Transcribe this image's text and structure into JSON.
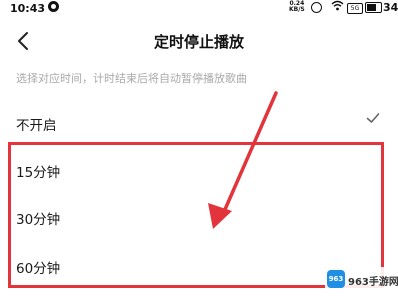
{
  "status_bar": {
    "time": "10:43",
    "speed_value": "0.24",
    "speed_unit": "KB/S",
    "signal_badge": "5G",
    "battery": "34",
    "battery_level": 0.34
  },
  "header": {
    "title": "定时停止播放"
  },
  "hint": "选择对应时间，计时结束后将自动暂停播放歌曲",
  "options": [
    {
      "label": "不开启",
      "selected": true
    },
    {
      "label": "15分钟",
      "selected": false
    },
    {
      "label": "30分钟",
      "selected": false
    },
    {
      "label": "60分钟",
      "selected": false
    }
  ],
  "annotation": {
    "highlight_color": "#e2343a"
  },
  "watermark": {
    "logo_text": "963",
    "text": "963手游网"
  }
}
